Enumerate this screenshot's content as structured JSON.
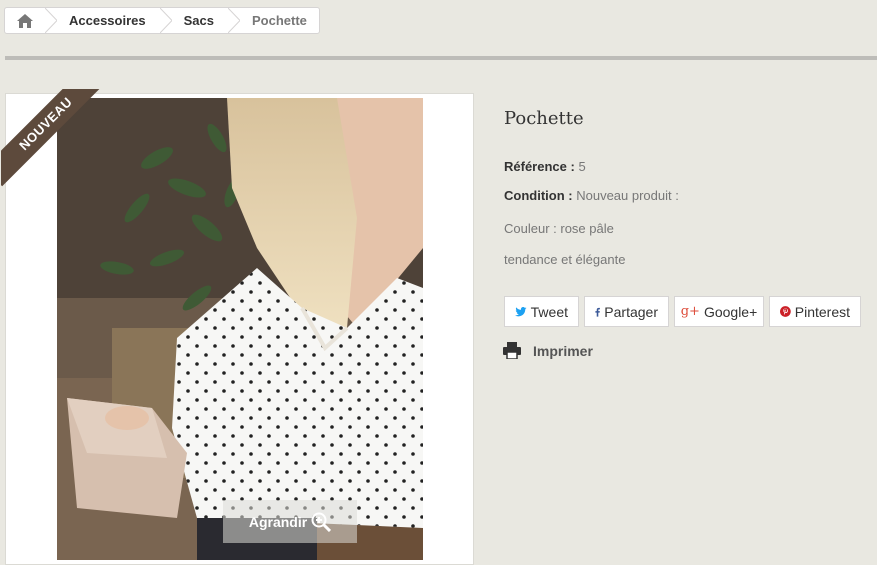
{
  "breadcrumb": {
    "home_icon": "home-icon",
    "items": [
      "Accessoires",
      "Sacs"
    ],
    "current": "Pochette"
  },
  "image": {
    "badge": "NOUVEAU",
    "enlarge_label": "Agrandir",
    "enlarge_icon": "zoom-in-icon"
  },
  "product": {
    "title": "Pochette",
    "reference_label": "Référence :",
    "reference_value": "5",
    "condition_label": "Condition :",
    "condition_value": "Nouveau produit :",
    "description": [
      "Couleur : rose pâle",
      "tendance et élégante"
    ]
  },
  "social": {
    "tweet": "Tweet",
    "share": "Partager",
    "google": "Google+",
    "pinterest": "Pinterest"
  },
  "print_label": "Imprimer",
  "colors": {
    "twitter": "#1da1f2",
    "facebook": "#3b5998",
    "google": "#dd4b39",
    "pinterest": "#cb2027",
    "badge": "#5d4a3c"
  }
}
